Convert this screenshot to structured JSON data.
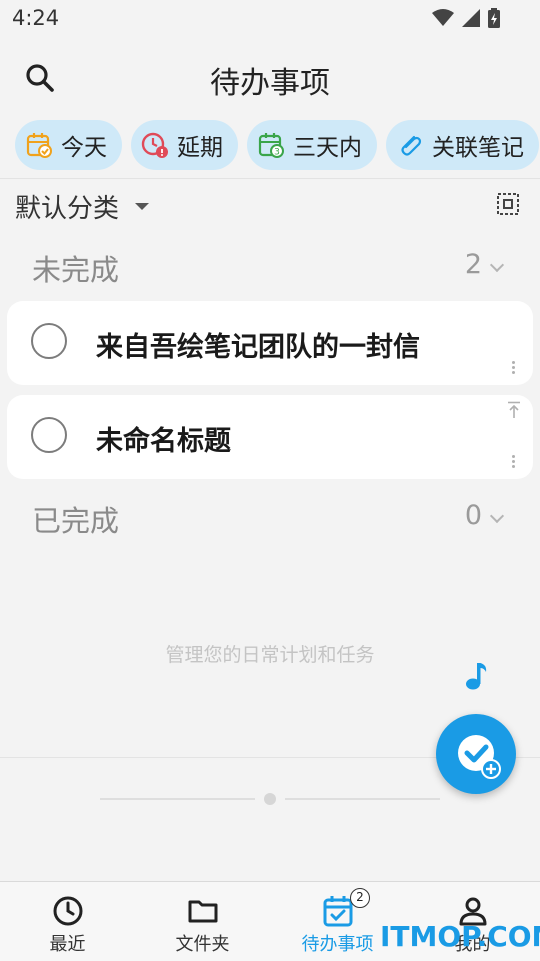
{
  "status_bar": {
    "time": "4:24"
  },
  "header": {
    "title": "待办事项"
  },
  "filters": [
    {
      "label": "今天",
      "icon": "calendar-check-icon",
      "color": "#f0a21c"
    },
    {
      "label": "延期",
      "icon": "clock-alert-icon",
      "color": "#e04a58"
    },
    {
      "label": "三天内",
      "icon": "calendar-three-icon",
      "color": "#3aa54a"
    },
    {
      "label": "关联笔记",
      "icon": "paperclip-icon",
      "color": "#1a9be5"
    }
  ],
  "category": {
    "label": "默认分类"
  },
  "sections": {
    "pending": {
      "title": "未完成",
      "count": "2"
    },
    "done": {
      "title": "已完成",
      "count": "0"
    }
  },
  "tasks": [
    {
      "title": "来自吾绘笔记团队的一封信"
    },
    {
      "title": "未命名标题"
    }
  ],
  "empty_hint": "管理您的日常计划和任务",
  "bottom_nav": [
    {
      "label": "最近",
      "icon": "clock-icon"
    },
    {
      "label": "文件夹",
      "icon": "folder-icon"
    },
    {
      "label": "待办事项",
      "icon": "calendar-todo-icon",
      "badge": "2",
      "active": true
    },
    {
      "label": "我的",
      "icon": "person-icon"
    }
  ],
  "watermark": "ITMOP.COM",
  "colors": {
    "accent": "#1a9be5",
    "chip_bg": "#cfe9f8",
    "background": "#f3f3f3"
  }
}
